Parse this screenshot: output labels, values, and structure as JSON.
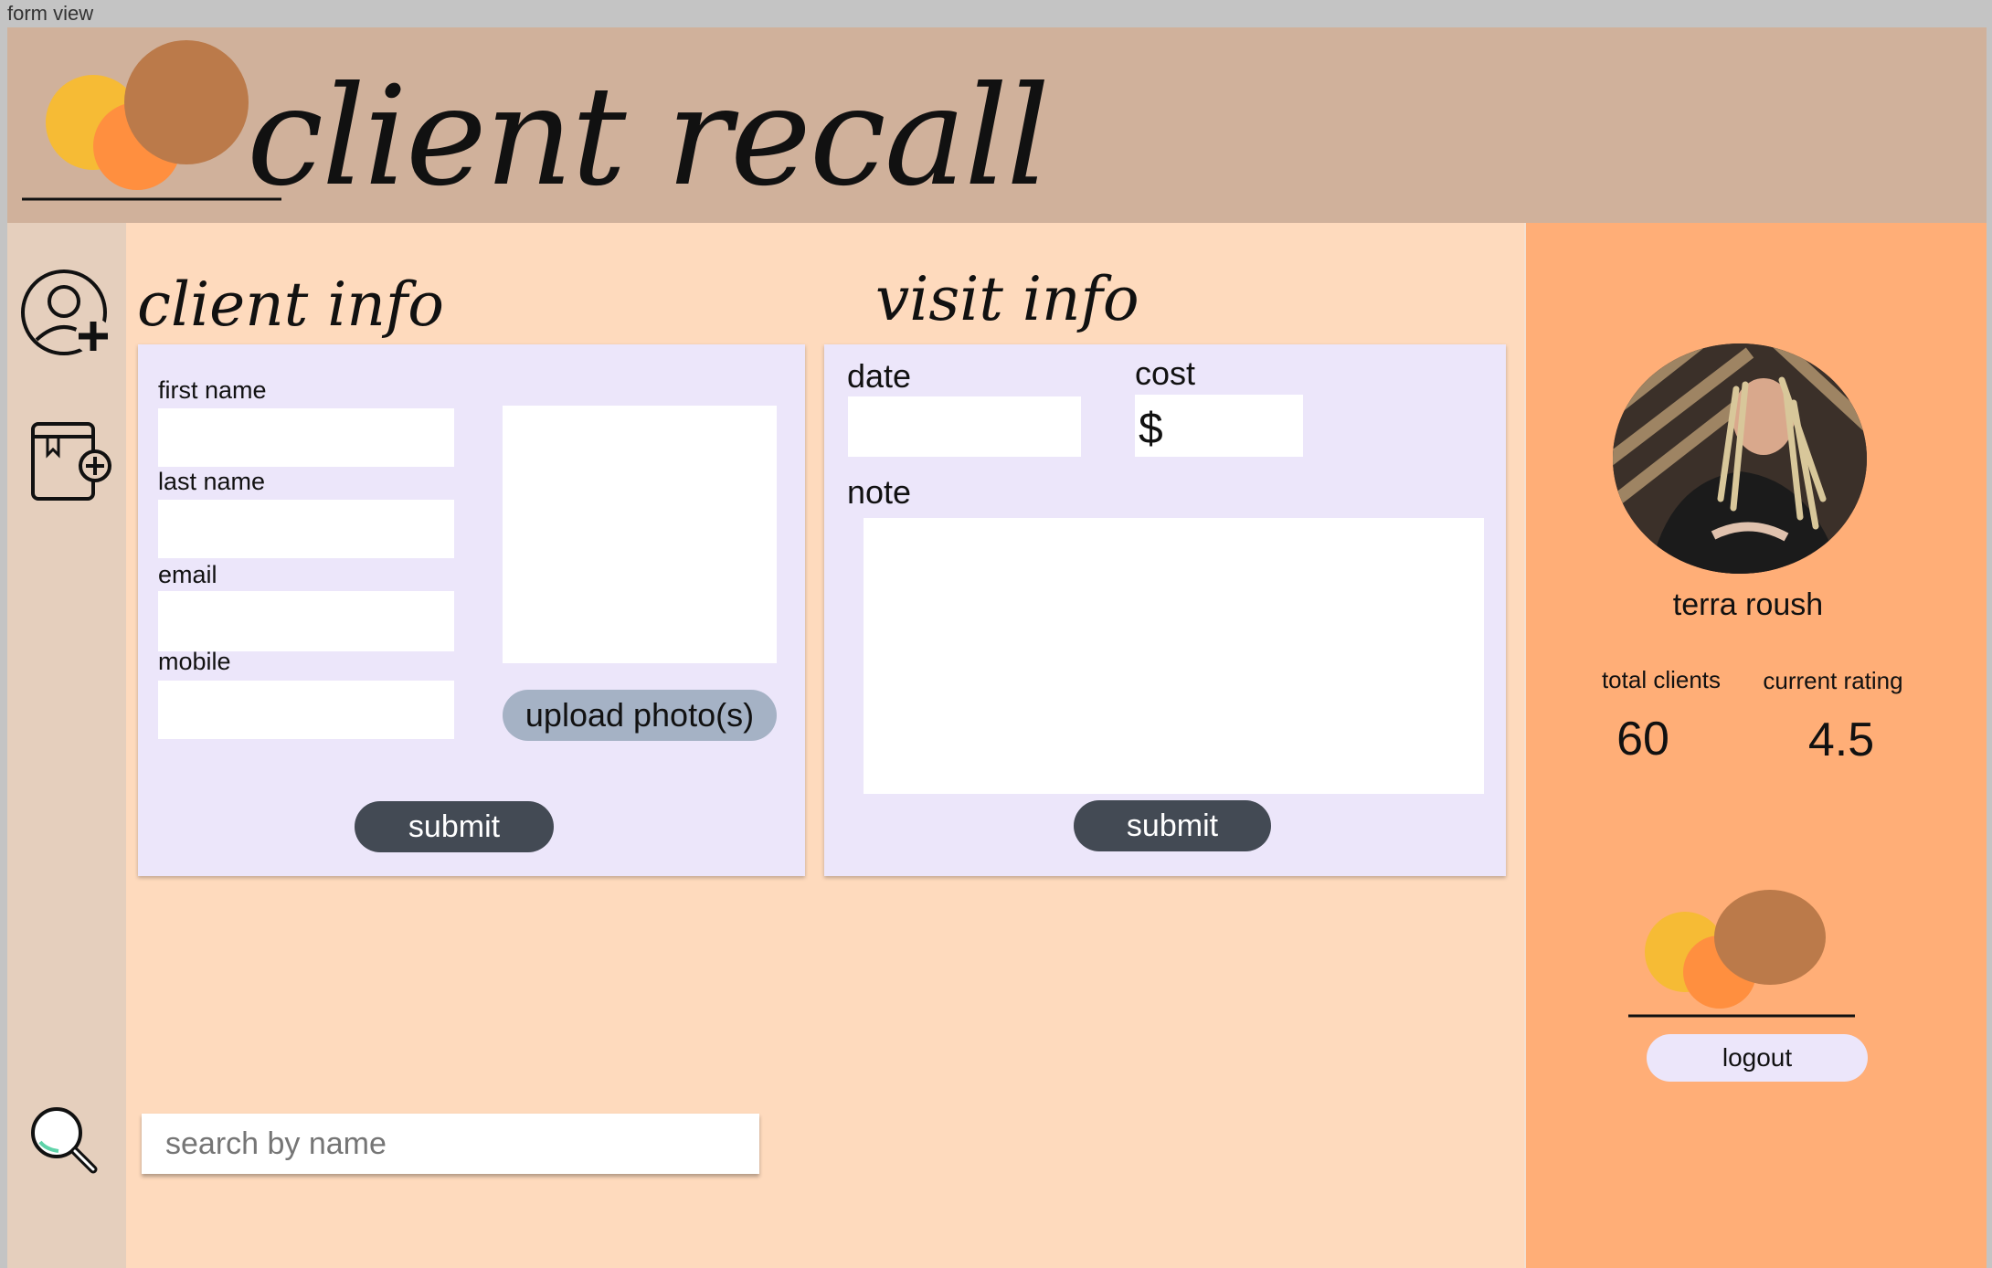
{
  "window": {
    "title": "form view"
  },
  "header": {
    "app_title": "client recall",
    "logo_icon": "three-circles-logo"
  },
  "sidebar": {
    "items": [
      {
        "icon": "add-user-icon"
      },
      {
        "icon": "add-book-icon"
      },
      {
        "icon": "search-icon"
      }
    ]
  },
  "client_info": {
    "title": "client info",
    "first_name_label": "first name",
    "last_name_label": "last name",
    "email_label": "email",
    "mobile_label": "mobile",
    "upload_label": "upload photo(s)",
    "submit_label": "submit"
  },
  "visit_info": {
    "title": "visit info",
    "date_label": "date",
    "cost_label": "cost",
    "cost_prefix": "$",
    "note_label": "note",
    "submit_label": "submit"
  },
  "search": {
    "placeholder": "search by name"
  },
  "profile": {
    "name": "terra roush",
    "total_clients_label": "total clients",
    "total_clients_value": "60",
    "rating_label": "current rating",
    "rating_value": "4.5",
    "logout_label": "logout"
  },
  "colors": {
    "header_bg": "#d0b19b",
    "sidebar_bg": "#e5cfbd",
    "main_bg": "#fedabd",
    "right_bg": "#ffae77",
    "card_bg": "#ece6fa",
    "button_dark": "#434a54",
    "upload_button": "#a5b2c5",
    "logo_yellow": "#f6bb35",
    "logo_orange": "#ff8f3f",
    "logo_brown": "#bb7a4a"
  }
}
